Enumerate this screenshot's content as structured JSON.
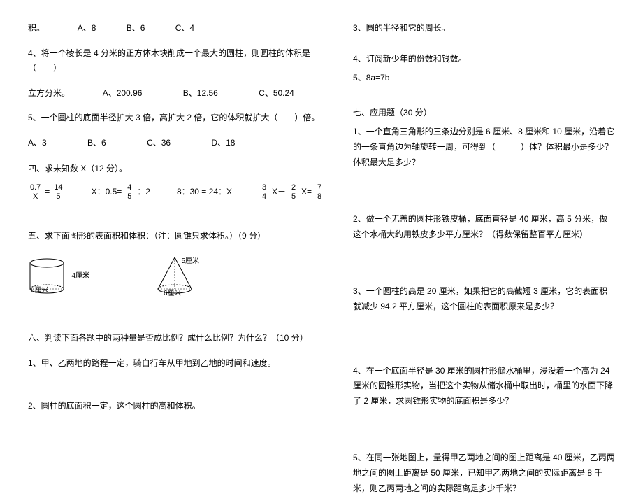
{
  "left": {
    "l1_prefix": "积。",
    "l1_A": "A、8",
    "l1_B": "B、6",
    "l1_C": "C、4",
    "l2": "4、将一个棱长是 4 分米的正方体木块削成一个最大的圆柱，则圆柱的体积是（　　）",
    "l3_prefix": "立方分米。",
    "l3_A": "A、200.96",
    "l3_B": "B、12.56",
    "l3_C": "C、50.24",
    "l4": "5、一个圆柱的底面半径扩大 3 倍，高扩大 2 倍，它的体积就扩大（　　）倍。",
    "l5_A": "A、3",
    "l5_B": "B、6",
    "l5_C": "C、36",
    "l5_D": "D、18",
    "sec4": "四、求未知数 X（12 分）。",
    "eq1_num1": "0.7",
    "eq1_den1": "X",
    "eq1_num2": "14",
    "eq1_den2": "5",
    "eq2_lhs": "X：0.5=",
    "eq2_num": "4",
    "eq2_den": "5",
    "eq2_rhs": "：2",
    "eq3": "8：30 = 24：X",
    "eq4_f1n": "3",
    "eq4_f1d": "4",
    "eq4_mid1": "X－",
    "eq4_f2n": "2",
    "eq4_f2d": "5",
    "eq4_mid2": "X=",
    "eq4_f3n": "7",
    "eq4_f3d": "8",
    "sec5": "五、求下面图形的表面积和体积：（注：圆锥只求体积。）（9 分）",
    "cyl_h": "4厘米",
    "cyl_d": "8厘米",
    "cone_s": "5厘米",
    "cone_b": "6厘米",
    "sec6": "六、判读下面各题中的两种量是否成比例？成什么比例？为什么？（10 分）",
    "q6_1": "1、甲、乙两地的路程一定，骑自行车从甲地到乙地的时间和速度。",
    "q6_2": "2、圆柱的底面积一定，这个圆柱的高和体积。"
  },
  "right": {
    "q3": "3、圆的半径和它的周长。",
    "q4": "4、订阅新少年的份数和钱数。",
    "q5": "5、8a=7b",
    "sec7": "七、应用题（30 分）",
    "a1": "1、一个直角三角形的三条边分别是 6 厘米、8 厘米和 10 厘米，沿着它的一条直角边为轴旋转一周，可得到（　　　）体？体积最小是多少？体积最大是多少？",
    "a2": "2、做一个无盖的圆柱形铁皮桶，底面直径是 40 厘米，高 5 分米，做这个水桶大约用铁皮多少平方厘米？（得数保留整百平方厘米）",
    "a3": "3、一个圆柱的高是 20 厘米，如果把它的高截短 3 厘米，它的表面积就减少 94.2 平方厘米，这个圆柱的表面积原来是多少？",
    "a4": "4、在一个底面半径是 30 厘米的圆柱形储水桶里，浸没着一个高为 24 厘米的圆锥形实物，当把这个实物从储水桶中取出时，桶里的水面下降了 2 厘米，求圆锥形实物的底面积是多少？",
    "a5": "5、在同一张地图上，量得甲乙两地之间的图上距离是 40 厘米，乙丙两地之间的图上距离是 50 厘米，已知甲乙两地之间的实际距离是 8 千米，则乙丙两地之间的实际距离是多少千米？"
  }
}
